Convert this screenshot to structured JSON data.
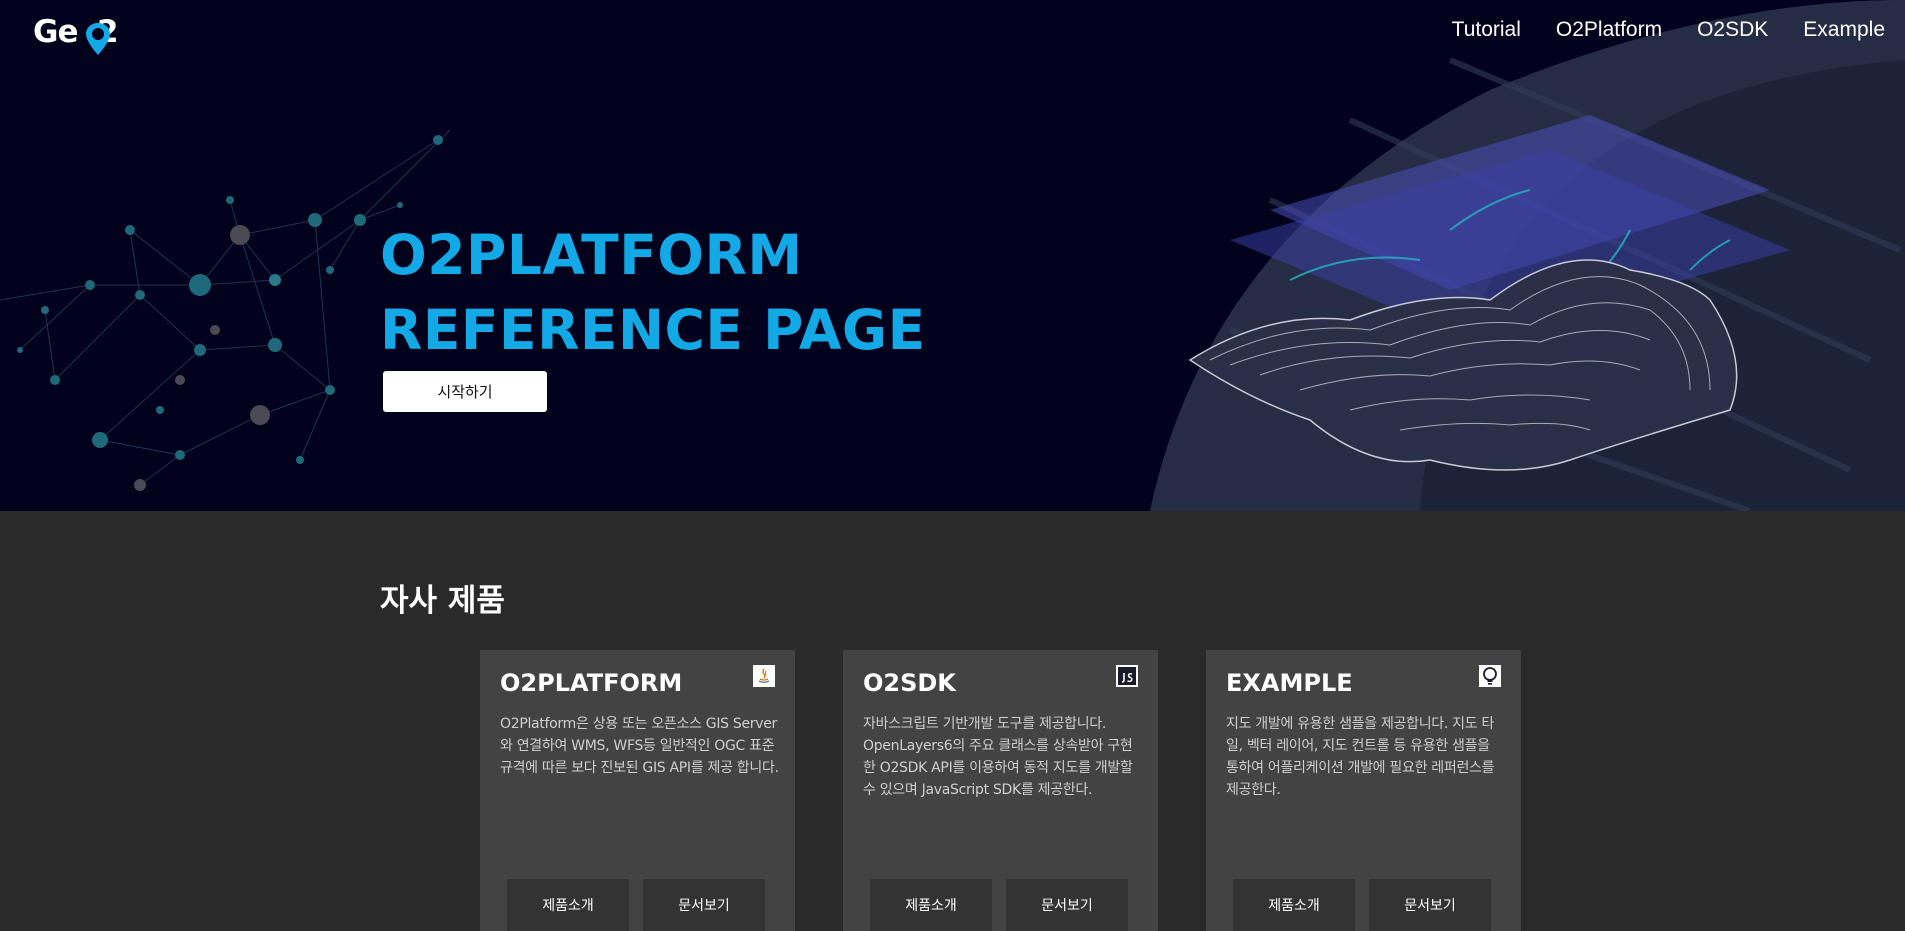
{
  "header": {
    "logo_text": "GeO2",
    "nav": [
      "Tutorial",
      "O2Platform",
      "O2SDK",
      "Example"
    ]
  },
  "hero": {
    "title_line1": "O2PLATFORM",
    "title_line2": "REFERENCE PAGE",
    "start_button": "시작하기"
  },
  "products": {
    "section_title": "자사 제품",
    "cards": [
      {
        "title": "O2PLATFORM",
        "icon": "java-icon",
        "description": "O2Platform은 상용 또는 오픈소스 GIS Server와 연결하여 WMS, WFS등 일반적인 OGC 표준 규격에 따른 보다 진보된 GIS API를 제공 합니다.",
        "intro_button": "제품소개",
        "docs_button": "문서보기"
      },
      {
        "title": "O2SDK",
        "icon": "js-icon",
        "description": "자바스크립트 기반개발 도구를 제공합니다. OpenLayers6의 주요 클래스를 상속받아 구현한 O2SDK API를 이용하여 동적 지도를 개발할 수 있으며 JavaScript SDK를 제공한다.",
        "intro_button": "제품소개",
        "docs_button": "문서보기"
      },
      {
        "title": "EXAMPLE",
        "icon": "lightbulb-icon",
        "description": "지도 개발에 유용한 샘플을 제공합니다. 지도 타일, 벡터 레이어, 지도 컨트롤 등 유용한 샘플을 통하여 어플리케이션 개발에 필요한 레퍼런스를 제공한다.",
        "intro_button": "제품소개",
        "docs_button": "문서보기"
      }
    ]
  },
  "colors": {
    "hero_bg": "#02021c",
    "accent": "#13a9e6",
    "section_bg": "#2a2a2a",
    "card_bg": "#434343"
  }
}
